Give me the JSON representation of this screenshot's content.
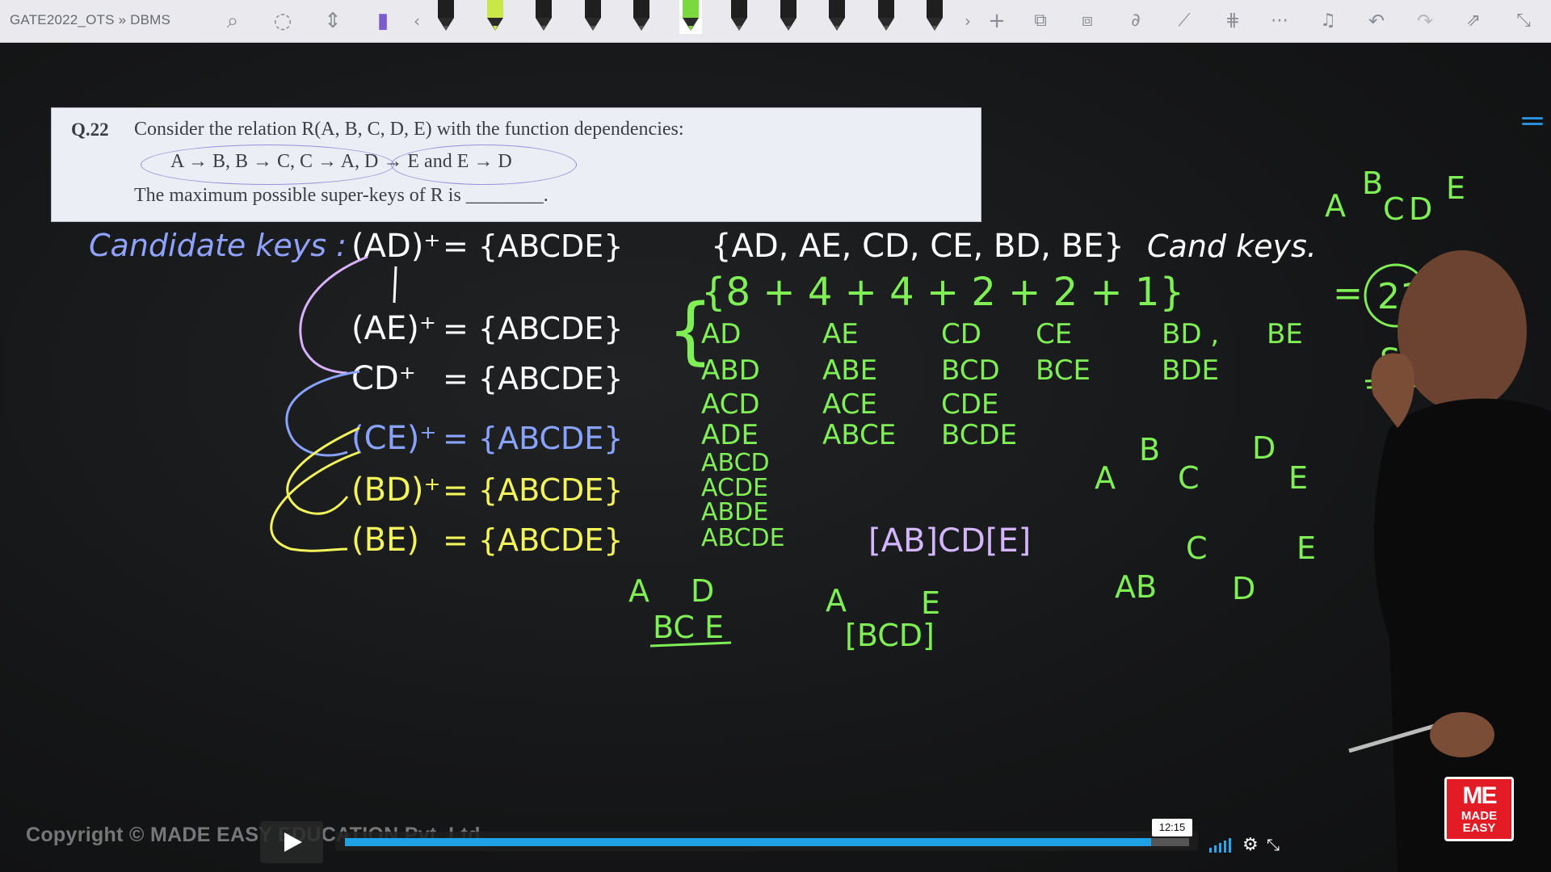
{
  "toolbar": {
    "breadcrumb": "GATE2022_OTS » DBMS",
    "icons": [
      "lasso-select-icon",
      "shape-select-icon",
      "insert-space-icon",
      "highlighter-icon",
      "chevron-left-icon",
      "pens",
      "chevron-right-icon",
      "add-icon",
      "shapes-icon",
      "convert-icon",
      "ink-to-math-icon",
      "ruler-icon",
      "grid-icon",
      "more-icon",
      "notification-icon",
      "undo-icon",
      "redo-icon",
      "share-icon",
      "collapse-icon"
    ],
    "pen_colors": [
      "#1f1f1f",
      "#c8e84a",
      "#1f1f1f",
      "#1f1f1f",
      "#1f1f1f",
      "#7bd83f",
      "#1f1f1f",
      "#1f1f1f",
      "#1f1f1f",
      "#1f1f1f",
      "#1f1f1f"
    ],
    "active_pen_index": 5
  },
  "question": {
    "number": "Q.22",
    "text": "Consider the relation R(A, B, C, D, E) with the function dependencies:",
    "dependencies": "A → B, B → C, C → A, D → E and E → D",
    "last_line": "The maximum possible super-keys of R is ________."
  },
  "board": {
    "candidate_heading": "Candidate keys :",
    "closures": [
      {
        "lhs": "(AD)⁺",
        "rhs": "= {ABCDE}",
        "color": "#ffffff"
      },
      {
        "lhs": "(AE)⁺",
        "rhs": "= {ABCDE}",
        "color": "#ffffff"
      },
      {
        "lhs": "CD⁺",
        "rhs": "= {ABCDE}",
        "color": "#ffffff"
      },
      {
        "lhs": "(CE)⁺",
        "rhs": "= {ABCDE}",
        "color": "#8aa2ff"
      },
      {
        "lhs": "(BD)⁺",
        "rhs": "= {ABCDE}",
        "color": "#f2f45a"
      },
      {
        "lhs": "(BE)",
        "rhs": "= {ABCDE}",
        "color": "#f2f45a"
      }
    ],
    "cand_keys_set": "{AD, AE, CD, CE, BD, BE}",
    "cand_keys_label": "Cand keys.",
    "sum_line": "{8 + 4 + 4 + 2 + 2 + 1}",
    "equals": "=",
    "result": "21",
    "sk_label": "SK",
    "columns": [
      [
        "AD",
        "ABD",
        "ACD",
        "ADE",
        "ABCD",
        "ACDE",
        "ABDE",
        "ABCDE"
      ],
      [
        "AE",
        "ABE",
        "ACE",
        "ABCE"
      ],
      [
        "CD",
        "BCD",
        "CDE",
        "BCDE"
      ],
      [
        "CE",
        "BCE"
      ],
      [
        "BD ,",
        "BDE"
      ],
      [
        "BE"
      ]
    ],
    "notes": {
      "top_right": [
        "A",
        "B",
        "C",
        "D",
        "E"
      ],
      "mid_right": [
        "A",
        "B",
        "C",
        "D",
        "E"
      ],
      "low_right": [
        "AB",
        "C",
        "D",
        "E"
      ],
      "bracket_expr": "[AB]CD[E]",
      "a_d": [
        "A",
        "D"
      ],
      "bce": "BC E",
      "a_bcd_e": [
        "A",
        "[BCD]",
        "E"
      ]
    }
  },
  "player": {
    "copyright": "Copyright © MADE EASY EDUCATION Pvt. Ltd.",
    "time": "12:15",
    "progress": 0.955,
    "play_icon": "play-icon",
    "settings_icon": "gear-icon",
    "fullscreen_icon": "fullscreen-icon",
    "volume_icon": "volume-bars-icon"
  },
  "logo": {
    "line1": "ME",
    "line2": "MADE",
    "line3": "EASY"
  }
}
